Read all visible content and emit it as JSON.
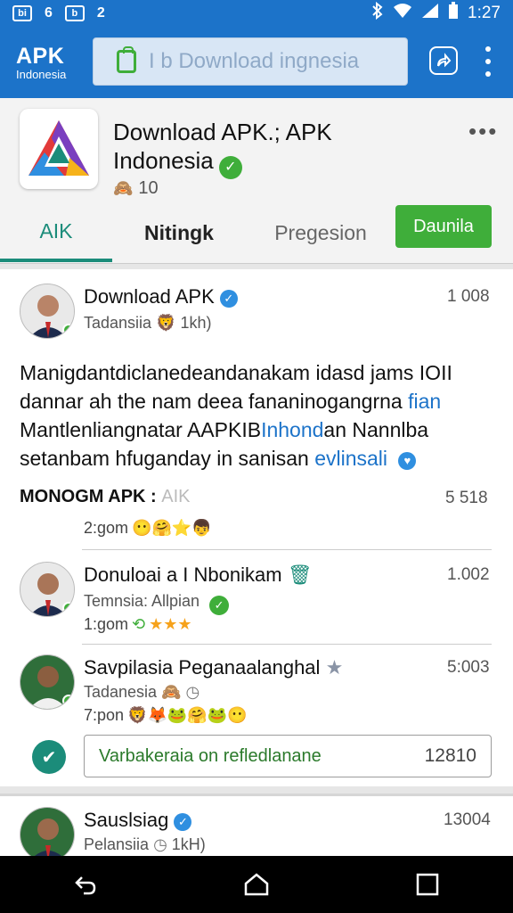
{
  "status_bar": {
    "left_icons": [
      "bi",
      "6",
      "b",
      "2"
    ],
    "time": "1:27"
  },
  "app_bar": {
    "brand_title": "APK",
    "brand_subtitle": "Indonesia",
    "search_text": "I b Download ingnesia"
  },
  "app_header": {
    "name_line1": "Download APK.; APK",
    "name_line2": "Indonesia",
    "rating": "10",
    "more": "•••"
  },
  "tabs": [
    {
      "label": "AIK",
      "active": true
    },
    {
      "label": "Nitingk",
      "active": false
    },
    {
      "label": "Pregesion",
      "active": false
    }
  ],
  "download_button": "Daunila",
  "post1": {
    "title": "Download APK",
    "subtitle": "Tadansiia",
    "subtitle_meta": "1kh)",
    "count": "1 008",
    "body_line1": "Manigdantdiclanedeandanakam idasd jams IOII",
    "body_line2": "dannar ah the nam deea fananinogangrna",
    "body_line2_link": "fian",
    "body_line3": "Mantlenliangnatar AAPKIB",
    "body_line3_link": "Inhond",
    "body_line3_end": "an Nannlba",
    "body_line4": "setanbam hfuganday in sanisan",
    "body_line4_link": "evlinsali",
    "footer_title": "MONOGM APK :",
    "footer_tag": "AIK",
    "footer_count": "5 518",
    "footer_meta": "2:gom"
  },
  "post2": {
    "title": "Donuloai a I Nbonikam",
    "subtitle": "Temnsia: Allpian",
    "meta": "1:gom",
    "count": "1.002"
  },
  "post3": {
    "title": "Savpilasia Peganaalanghal",
    "subtitle": "Tadanesia",
    "meta": "7:pon",
    "count": "5:003"
  },
  "reply": {
    "text": "Varbakeraia on refledlanane",
    "count": "12810"
  },
  "post4": {
    "title": "Sauslsiag",
    "subtitle": "Pelansiia",
    "subtitle_meta": "1kH)",
    "count": "13004"
  },
  "colors": {
    "primary": "#1c73c9",
    "accent_green": "#3fae3a",
    "tab_teal": "#1b8c7a"
  }
}
